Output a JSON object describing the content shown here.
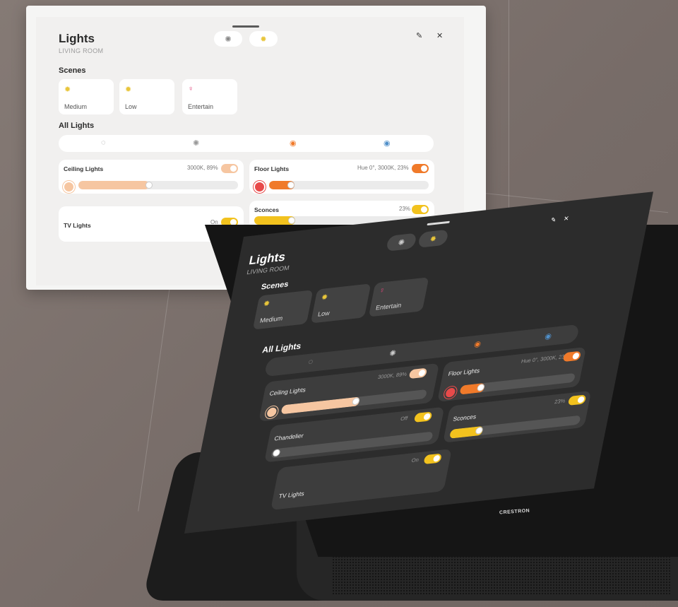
{
  "light_panel": {
    "title": "Lights",
    "subtitle": "LIVING ROOM",
    "scenes_heading": "Scenes",
    "scenes": [
      {
        "label": "Medium",
        "icon": "bulb-icon"
      },
      {
        "label": "Low",
        "icon": "bulb-icon"
      },
      {
        "label": "Entertain",
        "icon": "wine-glass-icon"
      }
    ],
    "all_lights_heading": "All Lights",
    "lights": [
      {
        "name": "Ceiling Lights",
        "status": "3000K, 89%",
        "level": 0.89
      },
      {
        "name": "Floor Lights",
        "status": "Hue 0°, 3000K, 23%",
        "level": 0.23
      },
      {
        "name": "Sconces",
        "status": "23%",
        "level": 0.23
      },
      {
        "name": "TV Lights",
        "status": "On"
      }
    ]
  },
  "device_panel": {
    "title": "Lights",
    "subtitle": "LIVING ROOM",
    "scenes_heading": "Scenes",
    "scenes": [
      {
        "label": "Medium"
      },
      {
        "label": "Low"
      },
      {
        "label": "Entertain"
      }
    ],
    "all_lights_heading": "All Lights",
    "lights": [
      {
        "name": "Ceiling Lights",
        "status": "3000K, 89%",
        "level": 0.89
      },
      {
        "name": "Floor Lights",
        "status": "Hue 0°, 3000K, 23%",
        "level": 0.23
      },
      {
        "name": "Chandelier",
        "status": "Off",
        "level": 0
      },
      {
        "name": "Sconces",
        "status": "23%",
        "level": 0.23
      },
      {
        "name": "TV Lights",
        "status": "On"
      }
    ],
    "brand": "CRESTRON"
  },
  "colors": {
    "peach": "#f6c6a1",
    "orange": "#f07a2a",
    "yellow": "#f2c21e",
    "scene_icon_yellow": "#e8c53a",
    "scene_icon_pink": "#e0457b"
  }
}
